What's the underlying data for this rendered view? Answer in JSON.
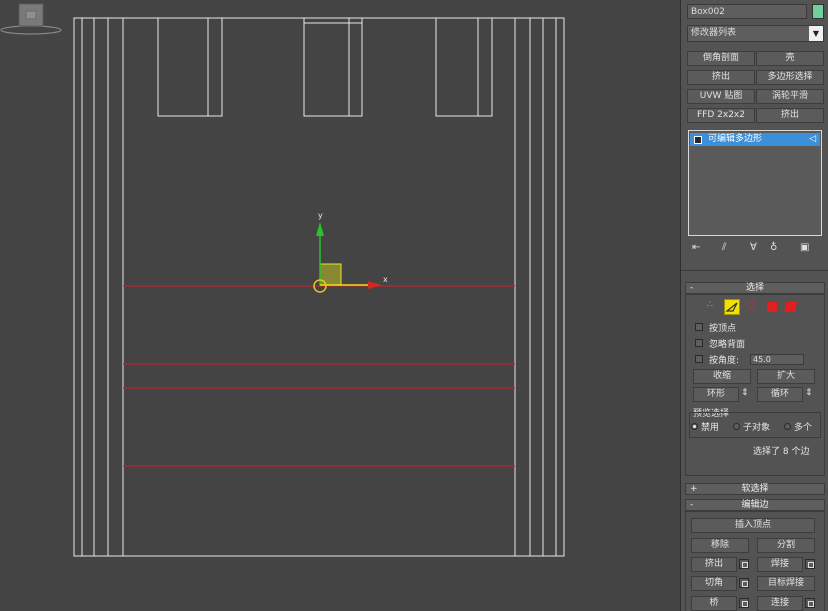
{
  "viewport": {
    "axis_x": "x",
    "axis_y": "y"
  },
  "panel": {
    "object_name": "Box002",
    "object_color": "#6fd09a",
    "modifier_list_label": "修改器列表",
    "modifier_buttons": [
      "倒角剖面",
      "壳",
      "挤出",
      "多边形选择",
      "UVW 贴图",
      "涡轮平滑",
      "FFD 2x2x2",
      "挤出"
    ],
    "stack_item": "可编辑多边形",
    "selection": {
      "title": "选择",
      "by_vertex": "按顶点",
      "ignore_backfacing": "忽略背面",
      "by_angle": "按角度:",
      "angle_value": "45.0",
      "shrink": "收缩",
      "grow": "扩大",
      "ring": "环形",
      "loop": "循环",
      "preview_title": "预览选择",
      "preview_off": "禁用",
      "preview_subobj": "子对象",
      "preview_multi": "多个",
      "status": "选择了 8 个边"
    },
    "soft_selection_title": "软选择",
    "edit_edges": {
      "title": "编辑边",
      "insert_vertex": "插入顶点",
      "remove": "移除",
      "split": "分割",
      "extrude": "挤出",
      "weld": "焊接",
      "chamfer": "切角",
      "target_weld": "目标焊接",
      "bridge": "桥",
      "connect": "连接"
    },
    "colors": {
      "active_subobject": "#f2e200",
      "stack_highlight": "#3d8fd9",
      "selected_edge": "#c8262d"
    }
  }
}
